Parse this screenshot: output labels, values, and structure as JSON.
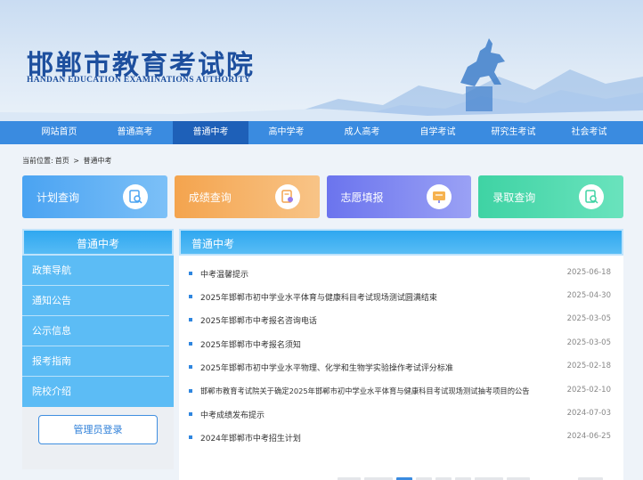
{
  "header": {
    "title_cn": "邯郸市教育考试院",
    "title_en": "HANDAN EDUCATION EXAMINATIONS AUTHORITY"
  },
  "nav": {
    "items": [
      "网站首页",
      "普通高考",
      "普通中考",
      "高中学考",
      "成人高考",
      "自学考试",
      "研究生考试",
      "社会考试"
    ],
    "active": "普通中考"
  },
  "breadcrumb": {
    "prefix": "当前位置:",
    "home": "首页",
    "sep": ">",
    "current": "普通中考"
  },
  "cards": [
    {
      "label": "计划查询",
      "icon": "search-doc-icon",
      "color": "#4aa3f2"
    },
    {
      "label": "成绩查询",
      "icon": "edit-doc-icon",
      "color": "#f4a44e"
    },
    {
      "label": "志愿填报",
      "icon": "board-icon",
      "color": "#6b74ee"
    },
    {
      "label": "录取查询",
      "icon": "search-doc-icon",
      "color": "#3fd3a4"
    }
  ],
  "sidebar": {
    "title": "普通中考",
    "items": [
      "政策导航",
      "通知公告",
      "公示信息",
      "报考指南",
      "院校介绍"
    ],
    "login": "管理员登录"
  },
  "main": {
    "title": "普通中考",
    "list": [
      {
        "title": "中考温馨提示",
        "date": "2025-06-18"
      },
      {
        "title": "2025年邯郸市初中学业水平体育与健康科目考试现场测试圆满结束",
        "date": "2025-04-30"
      },
      {
        "title": "2025年邯郸市中考报名咨询电话",
        "date": "2025-03-05"
      },
      {
        "title": "2025年邯郸市中考报名须知",
        "date": "2025-03-05"
      },
      {
        "title": "2025年邯郸市初中学业水平物理、化学和生物学实验操作考试评分标准",
        "date": "2025-02-18"
      },
      {
        "title": "邯郸市教育考试院关于确定2025年邯郸市初中学业水平体育与健康科目考试现场测试抽考项目的公告",
        "date": "2025-02-10"
      },
      {
        "title": "中考成绩发布提示",
        "date": "2024-07-03"
      },
      {
        "title": "2024年邯郸市中考招生计划",
        "date": "2024-06-25"
      }
    ]
  },
  "colors": {
    "nav": "#3a8be0",
    "nav_active": "#1e60b8",
    "brand": "#1d4f9e"
  }
}
